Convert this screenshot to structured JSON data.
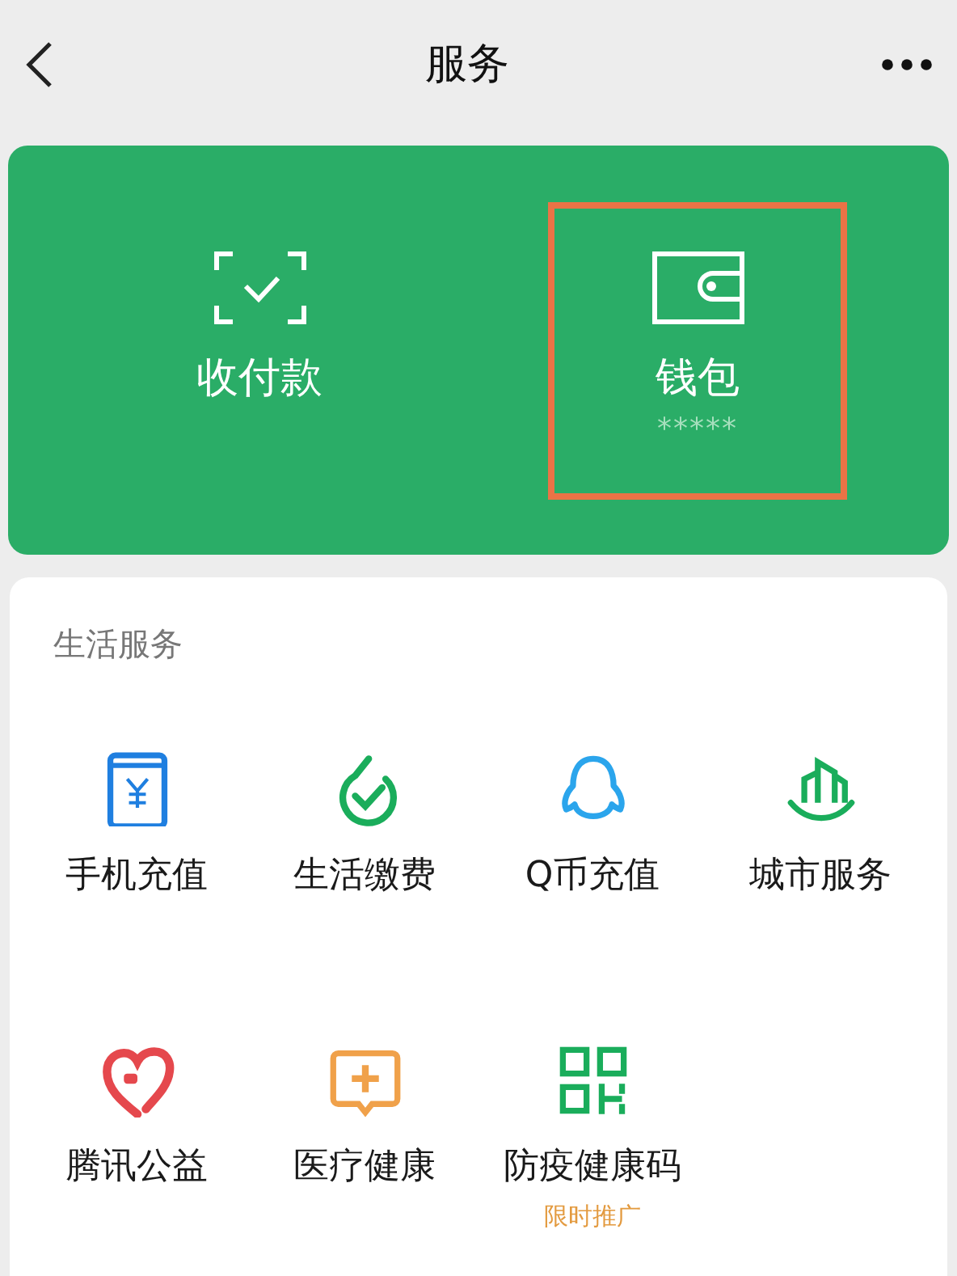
{
  "header": {
    "title": "服务"
  },
  "wallet_panel": [
    {
      "label": "收付款",
      "highlighted": false
    },
    {
      "label": "钱包",
      "sublabel": "*****",
      "highlighted": true
    }
  ],
  "life_services": {
    "title": "生活服务",
    "items": [
      {
        "label": "手机充值"
      },
      {
        "label": "生活缴费"
      },
      {
        "label": "Q币充值"
      },
      {
        "label": "城市服务"
      },
      {
        "label": "腾讯公益"
      },
      {
        "label": "医疗健康"
      },
      {
        "label": "防疫健康码",
        "badge": "限时推广"
      }
    ]
  }
}
